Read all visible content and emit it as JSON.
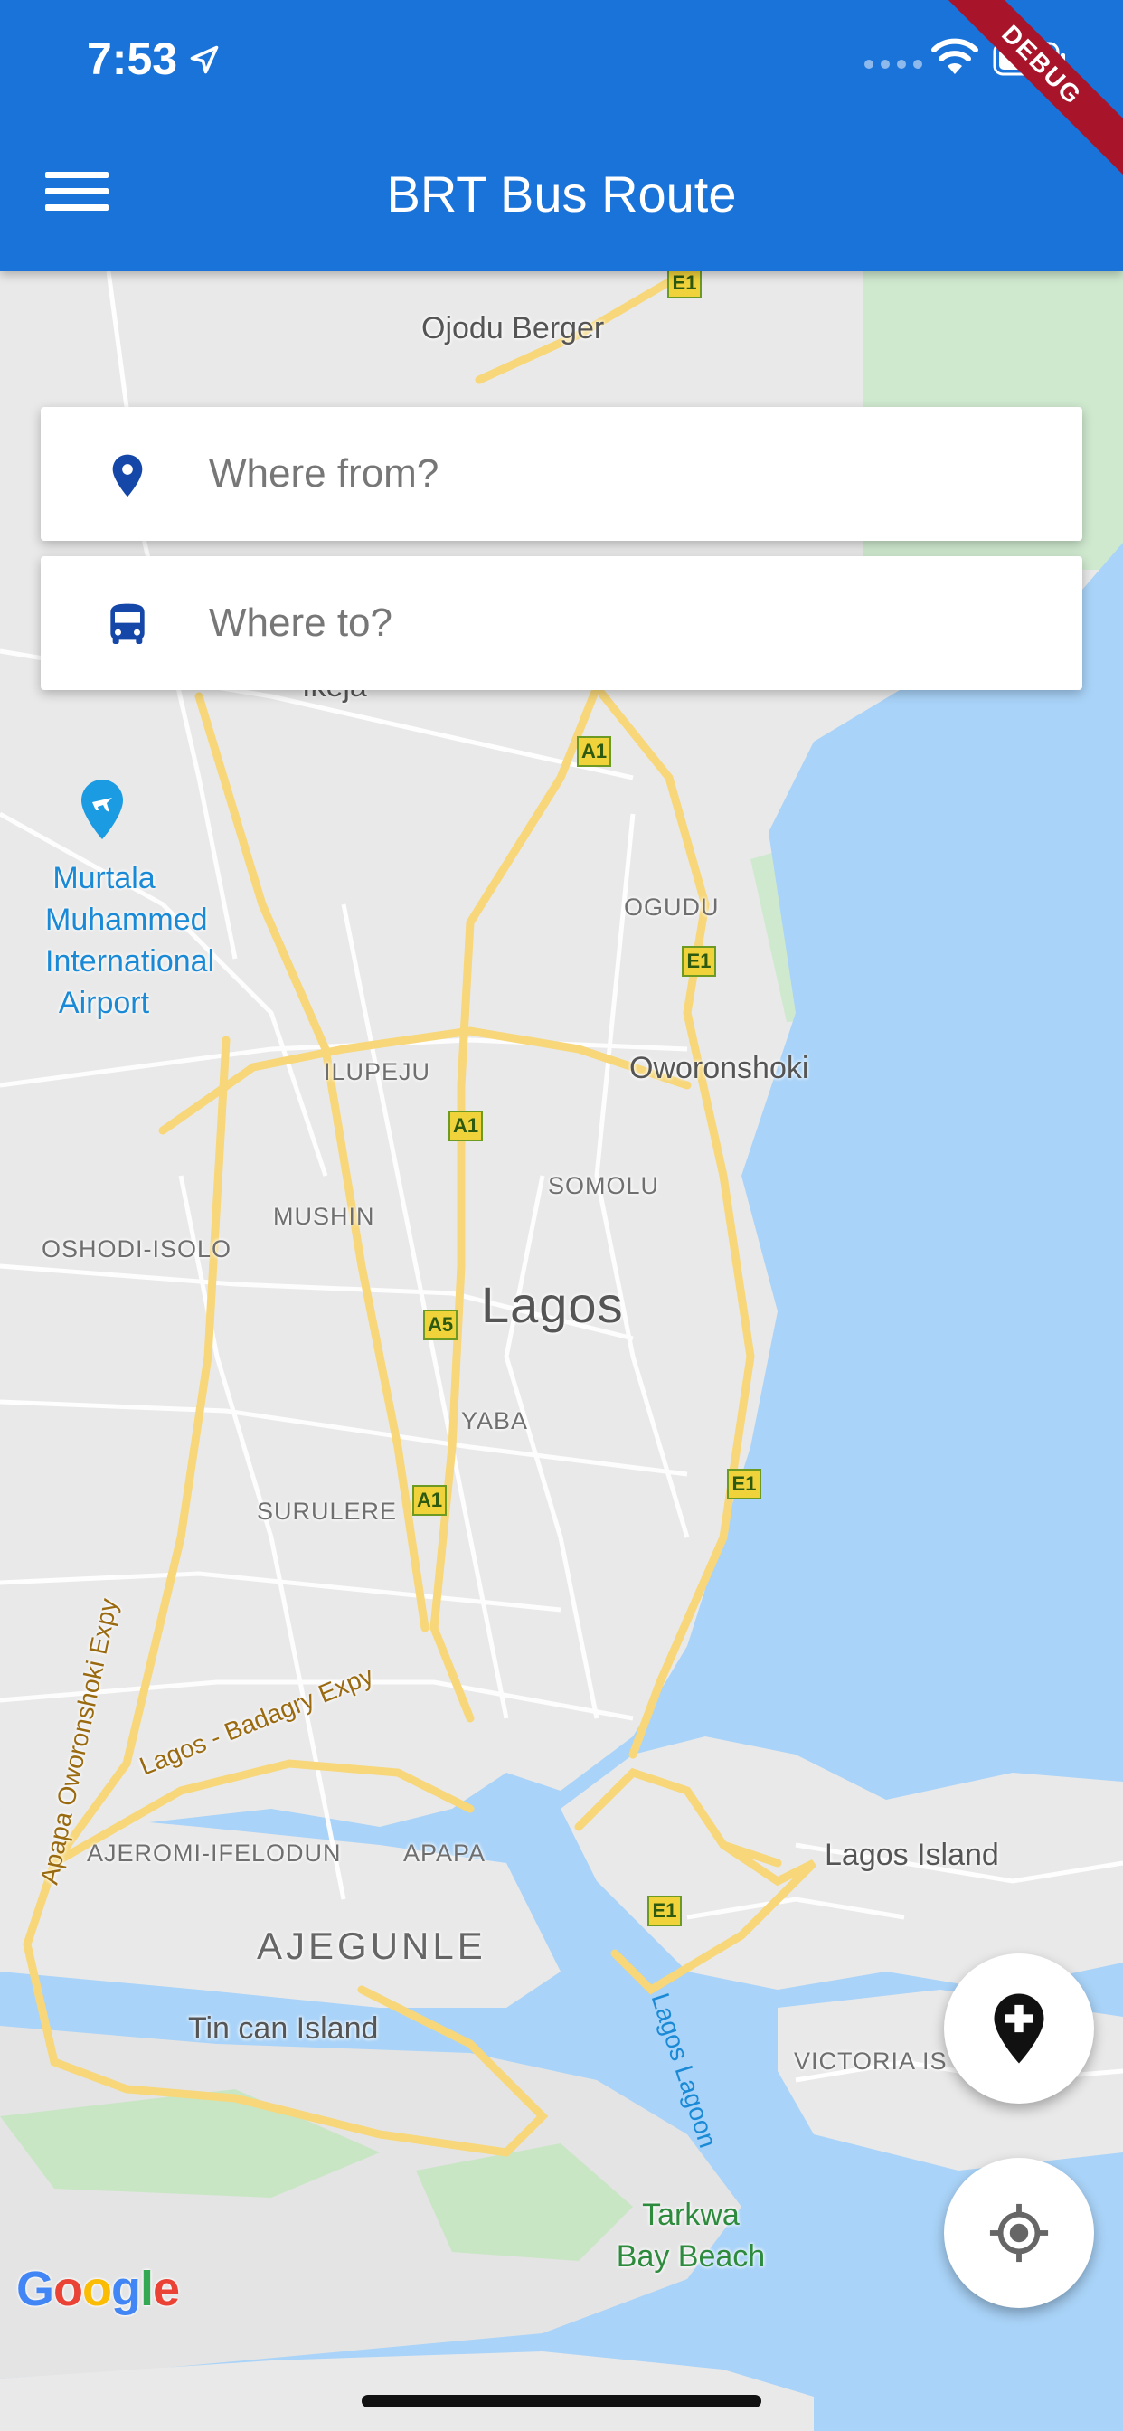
{
  "status_bar": {
    "time": "7:53"
  },
  "debug_badge": "DEBUG",
  "app_bar": {
    "title": "BRT Bus Route"
  },
  "search": {
    "from_placeholder": "Where from?",
    "to_placeholder": "Where to?"
  },
  "map": {
    "labels": {
      "ojodu_berger": "Ojodu Berger",
      "ikeja": "Ikeja",
      "airport": [
        "Murtala",
        "Muhammed",
        "International",
        "Airport"
      ],
      "ogudu": "OGUDU",
      "oworonshoki": "Oworonshoki",
      "ilupeju": "ILUPEJU",
      "somolu": "SOMOLU",
      "mushin": "MUSHIN",
      "oshodi_isolo": "OSHODI-ISOLO",
      "lagos": "Lagos",
      "yaba": "YABA",
      "surulere": "SURULERE",
      "apapa_oworonshoki_expy": "Apapa Oworonshoki Expy",
      "lagos_badagry_expy": "Lagos - Badagry Expy",
      "ajeromi_ifelodun": "AJEROMI-IFELODUN",
      "apapa": "APAPA",
      "lagos_island": "Lagos Island",
      "ajegunle": "AJEGUNLE",
      "tin_can_island": "Tin can Island",
      "lagos_lagoon": "Lagos Lagoon",
      "victoria_island": "VICTORIA IS",
      "tarkwa_bay_beach": [
        "Tarkwa",
        "Bay Beach"
      ],
      "google": "Google"
    },
    "shields": {
      "e1": "E1",
      "a1": "A1",
      "a5": "A5"
    }
  },
  "colors": {
    "app_bar": "#1a73d9",
    "icon_blue": "#1547a8",
    "water": "#a9d3f8",
    "land": "#e9e9e9",
    "road": "#f7d77a",
    "debug_ribbon": "#a8152b"
  }
}
